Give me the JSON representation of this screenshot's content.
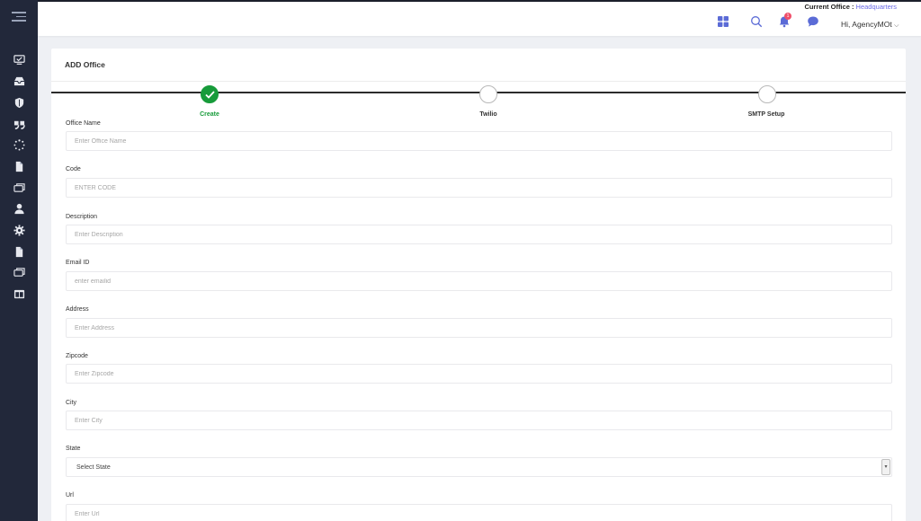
{
  "topbar": {
    "office_label": "Current Office :",
    "office_value": "Headquarters",
    "notification_count": "1",
    "greeting": "Hi, AgencyMOt",
    "chevron": "⌵"
  },
  "card": {
    "title": "ADD Office"
  },
  "steps": [
    {
      "label": "Create",
      "state": "done"
    },
    {
      "label": "Twilio",
      "state": "pending"
    },
    {
      "label": "SMTP Setup",
      "state": "pending"
    }
  ],
  "form": {
    "office_name": {
      "label": "Office Name",
      "placeholder": "Enter Office Name"
    },
    "code": {
      "label": "Code",
      "placeholder": "ENTER CODE"
    },
    "description": {
      "label": "Description",
      "placeholder": "Enter Description"
    },
    "email": {
      "label": "Email ID",
      "placeholder": "enter emailid"
    },
    "address": {
      "label": "Address",
      "placeholder": "Enter Address"
    },
    "zipcode": {
      "label": "Zipcode",
      "placeholder": "Enter Zipcode"
    },
    "city": {
      "label": "City",
      "placeholder": "Enter City"
    },
    "state": {
      "label": "State",
      "selected": "Select State"
    },
    "url": {
      "label": "Url",
      "placeholder": "Enter Url"
    }
  },
  "colors": {
    "sidebar_bg": "#22283a",
    "accent_purple": "#6a6ae6",
    "success_green": "#179b3a",
    "badge_red": "#f04f6a"
  },
  "icons": {
    "sidebar": [
      "monitor-icon",
      "inbox-icon",
      "shield-icon",
      "quote-icon",
      "spinner-icon",
      "document-icon",
      "windows-icon",
      "user-icon",
      "gear-icon",
      "file-icon",
      "windows-icon",
      "columns-icon"
    ],
    "topbar": [
      "grid-icon",
      "search-icon",
      "bell-icon",
      "chat-icon"
    ]
  }
}
